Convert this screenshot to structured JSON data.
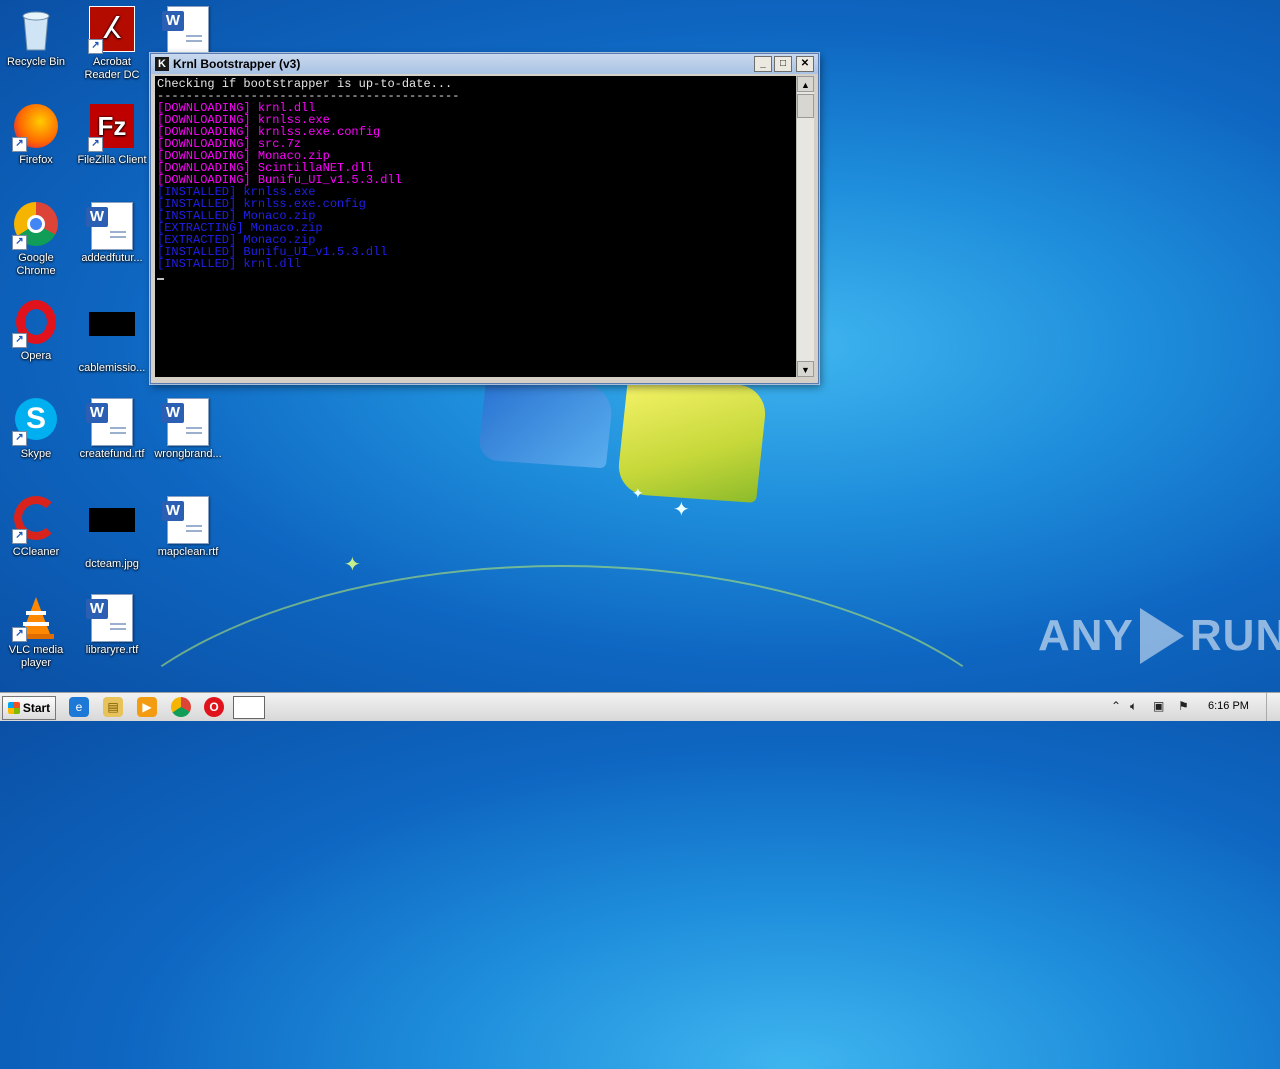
{
  "desktop": {
    "icons": [
      {
        "label": "Recycle Bin",
        "name": "recycle-bin"
      },
      {
        "label": "Acrobat Reader DC",
        "name": "acrobat-reader"
      },
      {
        "label": "",
        "name": "word-doc-top"
      },
      {
        "label": "Firefox",
        "name": "firefox"
      },
      {
        "label": "FileZilla Client",
        "name": "filezilla"
      },
      {
        "label": "Google Chrome",
        "name": "google-chrome"
      },
      {
        "label": "addedfutur...",
        "name": "addedfuture-doc"
      },
      {
        "label": "Opera",
        "name": "opera"
      },
      {
        "label": "cablemissio...",
        "name": "cablemission-file"
      },
      {
        "label": "Skype",
        "name": "skype"
      },
      {
        "label": "createfund.rtf",
        "name": "createfund-doc"
      },
      {
        "label": "wrongbrand...",
        "name": "wrongbrand-doc"
      },
      {
        "label": "CCleaner",
        "name": "ccleaner"
      },
      {
        "label": "dcteam.jpg",
        "name": "dcteam-file"
      },
      {
        "label": "mapclean.rtf",
        "name": "mapclean-doc"
      },
      {
        "label": "VLC media player",
        "name": "vlc"
      },
      {
        "label": "libraryre.rtf",
        "name": "libraryre-doc"
      }
    ]
  },
  "window": {
    "title": "Krnl Bootstrapper (v3)",
    "minimize": "_",
    "maximize": "□",
    "close": "✕",
    "console_lines": [
      {
        "text": "Checking if bootstrapper is up-to-date...",
        "color": "white"
      },
      {
        "text": "------------------------------------------",
        "color": "white"
      },
      {
        "text": "[DOWNLOADING] krnl.dll",
        "color": "magenta"
      },
      {
        "text": "[DOWNLOADING] krnlss.exe",
        "color": "magenta"
      },
      {
        "text": "[DOWNLOADING] krnlss.exe.config",
        "color": "magenta"
      },
      {
        "text": "[DOWNLOADING] src.7z",
        "color": "magenta"
      },
      {
        "text": "[DOWNLOADING] Monaco.zip",
        "color": "magenta"
      },
      {
        "text": "[DOWNLOADING] ScintillaNET.dll",
        "color": "magenta"
      },
      {
        "text": "[DOWNLOADING] Bunifu_UI_v1.5.3.dll",
        "color": "magenta"
      },
      {
        "text": "[INSTALLED] krnlss.exe",
        "color": "blue"
      },
      {
        "text": "[INSTALLED] krnlss.exe.config",
        "color": "blue"
      },
      {
        "text": "[INSTALLED] Monaco.zip",
        "color": "blue"
      },
      {
        "text": "[EXTRACTING] Monaco.zip",
        "color": "blue"
      },
      {
        "text": "[EXTRACTED] Monaco.zip",
        "color": "blue"
      },
      {
        "text": "[INSTALLED] Bunifu_UI_v1.5.3.dll",
        "color": "blue"
      },
      {
        "text": "[INSTALLED] krnl.dll",
        "color": "blue"
      }
    ]
  },
  "taskbar": {
    "start_label": "Start",
    "clock": "6:16 PM"
  },
  "watermark": {
    "left": "ANY",
    "right": "RUN"
  },
  "colors": {
    "magenta": "#ff00ff",
    "blue": "#1f1ff0",
    "white": "#e6e6e6"
  }
}
